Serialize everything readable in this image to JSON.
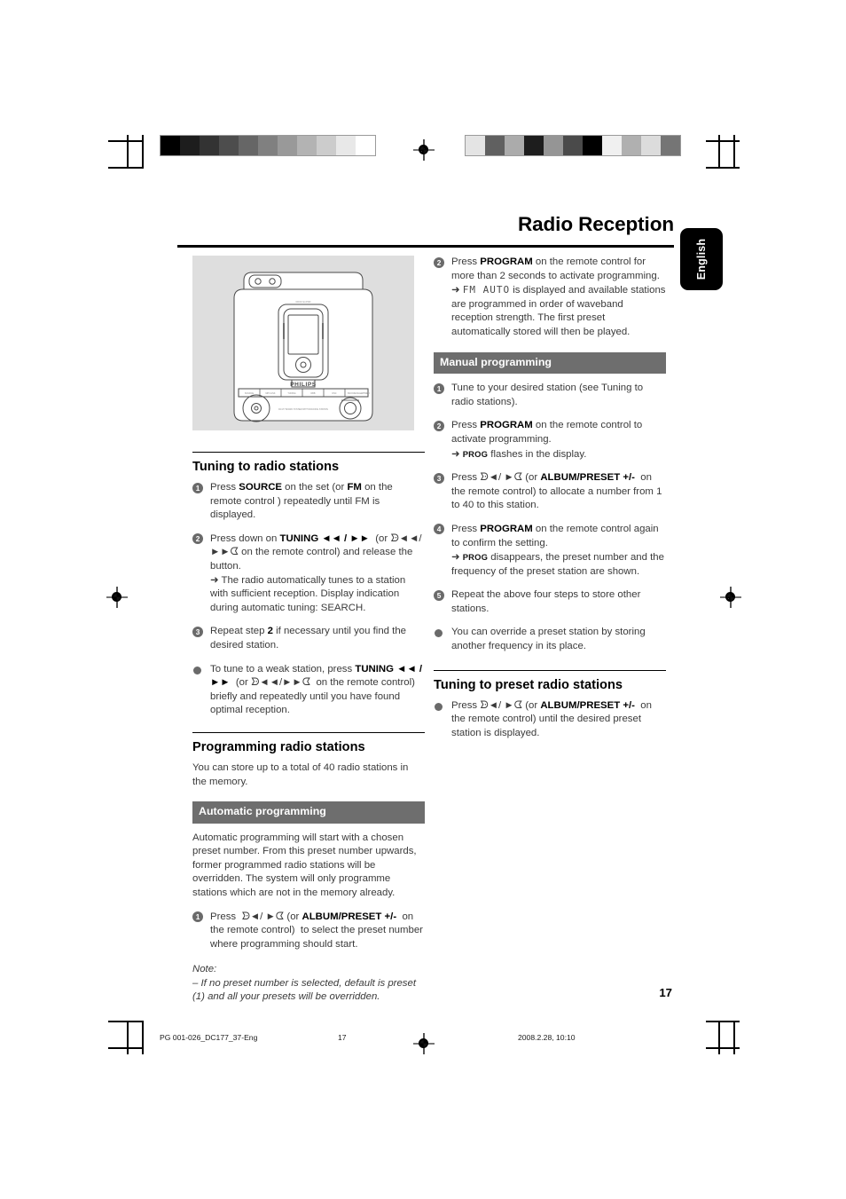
{
  "page": {
    "title": "Radio Reception",
    "language_tab": "English",
    "page_number": "17"
  },
  "footer": {
    "document_id": "PG 001-026_DC177_37-Eng",
    "page_number": "17",
    "timestamp": "2008.2.28, 10:10"
  },
  "figure": {
    "brand": "PHILIPS",
    "caption_name": "philips-docking-entertainment-system-line-drawing"
  },
  "calibration": {
    "left_bar": [
      "#000000",
      "#1d1d1d",
      "#333333",
      "#4d4d4d",
      "#666666",
      "#808080",
      "#999999",
      "#b3b3b3",
      "#cccccc",
      "#e8e8e8",
      "#ffffff"
    ],
    "right_bar": [
      "#e4e4e4",
      "#606060",
      "#ababab",
      "#1d1d1d",
      "#959595",
      "#4a4a4a",
      "#000000",
      "#f0f0f0",
      "#b0b0b0",
      "#dcdcdc",
      "#757575"
    ]
  },
  "left_column": {
    "section1": {
      "heading": "Tuning to radio stations",
      "steps": [
        {
          "num": "1",
          "html": "Press <b>SOURCE</b> on the set (or <b>FM</b> on the remote control ) repeatedly until FM is displayed."
        },
        {
          "num": "2",
          "html": "Press down on <b>TUNING ◄◄ / ►►</b> &nbsp;(or ᗦ◄◄/ ►►ᗧ on the remote control) and release the button.<br>➜ The radio automatically tunes to a station with sufficient reception. Display indication during automatic tuning: SEARCH."
        },
        {
          "num": "3",
          "html": "Repeat step <b>2</b> if necessary until you find the desired station."
        }
      ],
      "bullets": [
        {
          "html": "To tune to a weak station, press <b>TUNING ◄◄ / ►►</b> &nbsp;(or ᗦ◄◄/►►ᗧ &nbsp;on the remote control) briefly and repeatedly until you have found optimal reception."
        }
      ]
    },
    "section2": {
      "heading": "Programming radio stations",
      "intro": "You can store up to a total of 40 radio stations in the memory.",
      "band": "Automatic programming",
      "body": "Automatic programming will start with a chosen preset number. From this preset number upwards, former programmed radio stations will be overridden. The system will only programme stations which are not in the memory already.",
      "steps": [
        {
          "num": "1",
          "html": "Press &nbsp;ᗦ◄/ ►ᗧ (or <b>ALBUM/PRESET +/-</b> &nbsp;on the remote control) &nbsp;to select the preset number where programming should start."
        }
      ],
      "note_label": "Note:",
      "note_text": "–  If no preset number is selected, default is preset (1) and all your presets will be overridden."
    }
  },
  "right_column": {
    "continued_step": {
      "num": "2",
      "html": "Press <b>PROGRAM</b> on the remote control for more than 2 seconds to activate programming.<br>➜ <span class=\"lcd\">FM AUTO</span> is displayed and available stations are programmed in order of waveband reception strength. The first preset automatically stored will then be played."
    },
    "section_manual": {
      "band": "Manual programming",
      "steps": [
        {
          "num": "1",
          "html": "Tune to your desired station (see Tuning to radio stations)."
        },
        {
          "num": "2",
          "html": "Press <b>PROGRAM</b> on the remote control to activate programming.<br>➜ <span class=\"smallcap\">PROG</span> flashes in the display."
        },
        {
          "num": "3",
          "html": "Press ᗦ◄/ ►ᗧ (or <b>ALBUM/PRESET +/-</b> &nbsp;on the remote control) to allocate a number from 1 to 40 to this station."
        },
        {
          "num": "4",
          "html": "Press <b>PROGRAM</b> on the remote control again to confirm the setting.<br>➜ <span class=\"smallcap\">PROG</span> disappears, the preset number and the frequency of the preset station are shown."
        },
        {
          "num": "5",
          "html": "Repeat the above four steps to store other stations."
        }
      ],
      "bullets": [
        {
          "html": "You can override a preset station by storing another frequency in its place."
        }
      ]
    },
    "section_preset": {
      "heading": "Tuning to preset radio stations",
      "bullets": [
        {
          "html": "Press ᗦ◄/ ►ᗧ (or <b>ALBUM/PRESET +/-</b> &nbsp;on the remote control) until the desired preset station is displayed."
        }
      ]
    }
  }
}
